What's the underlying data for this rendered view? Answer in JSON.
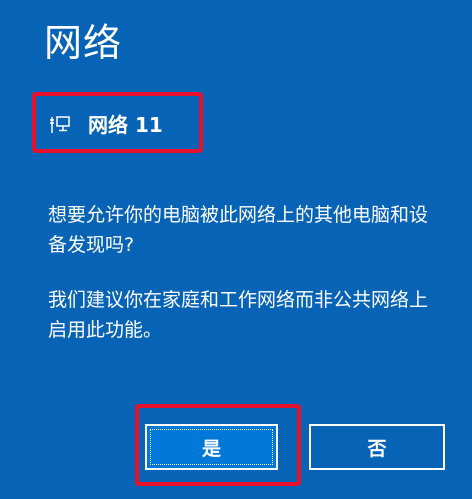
{
  "dialog": {
    "title": "网络",
    "network_name": "网络 11",
    "network_icon": "wired-network-icon",
    "question": "想要允许你的电脑被此网络上的其他电脑和设备发现吗?",
    "recommendation": "我们建议你在家庭和工作网络而非公共网络上启用此功能。",
    "buttons": {
      "yes_label": "是",
      "no_label": "否"
    }
  },
  "colors": {
    "background": "#0763b6",
    "yes_button": "#0078d7",
    "highlight": "#e8112d",
    "text": "#ffffff"
  }
}
